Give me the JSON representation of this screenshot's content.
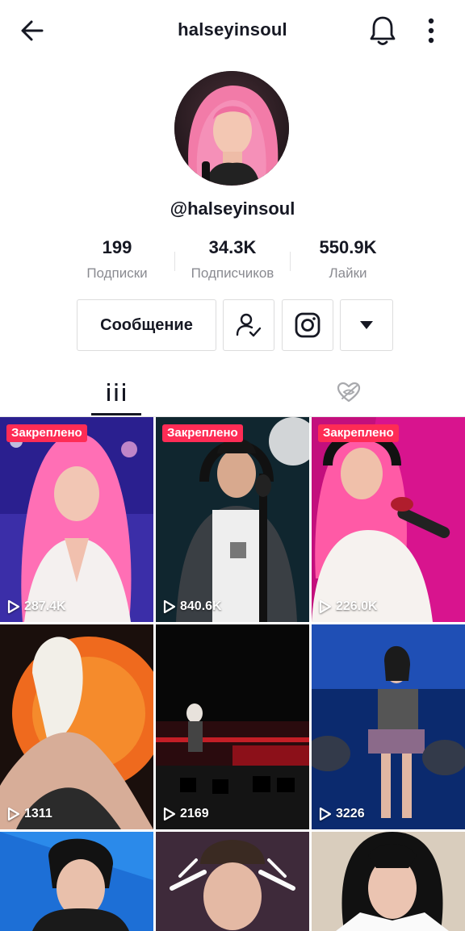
{
  "header": {
    "title": "halseyinsoul",
    "back_icon": "arrow-left-icon",
    "bell_icon": "bell-icon",
    "more_icon": "more-vertical-icon"
  },
  "profile": {
    "handle": "@halseyinsoul",
    "avatar_icon": "avatar-photo"
  },
  "stats": [
    {
      "value": "199",
      "label": "Подписки"
    },
    {
      "value": "34.3K",
      "label": "Подписчиков"
    },
    {
      "value": "550.9K",
      "label": "Лайки"
    }
  ],
  "actions": {
    "message_label": "Сообщение",
    "following_icon": "user-check-icon",
    "instagram_icon": "instagram-icon",
    "dropdown_icon": "caret-down-icon"
  },
  "tabs": [
    {
      "name": "videos",
      "icon": "grid-bars-icon",
      "active": true
    },
    {
      "name": "liked",
      "icon": "heart-hidden-icon",
      "active": false
    }
  ],
  "videos": [
    {
      "pinned": "Закреплено",
      "views": "287.4K"
    },
    {
      "pinned": "Закреплено",
      "views": "840.6K"
    },
    {
      "pinned": "Закреплено",
      "views": "226.0K"
    },
    {
      "pinned": "",
      "views": "1311"
    },
    {
      "pinned": "",
      "views": "2169"
    },
    {
      "pinned": "",
      "views": "3226"
    },
    {
      "pinned": "",
      "views": ""
    },
    {
      "pinned": "",
      "views": ""
    },
    {
      "pinned": "",
      "views": ""
    }
  ],
  "colors": {
    "accent": "#fe2c55",
    "text": "#161823",
    "muted": "#8a8b91"
  }
}
